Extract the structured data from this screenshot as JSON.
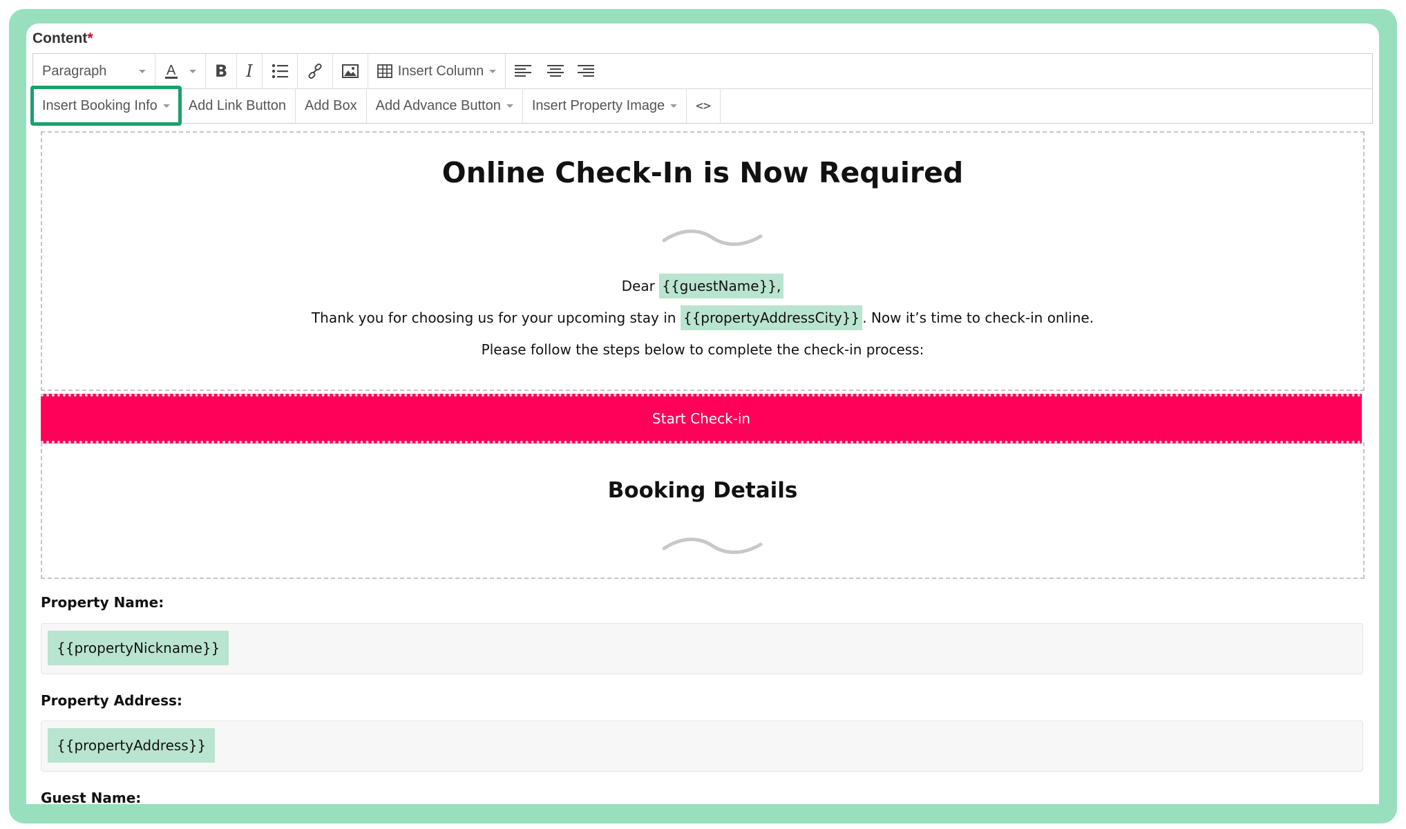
{
  "form": {
    "content_label": "Content",
    "required_mark": "*"
  },
  "toolbar": {
    "paragraph_select": "Paragraph",
    "insert_column": "Insert Column",
    "insert_booking_info": "Insert Booking Info",
    "add_link_button": "Add Link Button",
    "add_box": "Add Box",
    "add_advance_button": "Add Advance Button",
    "insert_property_image": "Insert Property Image",
    "code_view": "<>",
    "highlight_color": "#1aa06c"
  },
  "email": {
    "title": "Online Check-In is Now Required",
    "greeting_prefix": "Dear ",
    "guest_name_tag": "{{guestName}},",
    "line2_prefix": "Thank you for choosing us for your upcoming stay in ",
    "city_tag": "{{propertyAddressCity}}",
    "line2_suffix": ". Now it’s time to check-in online.",
    "line3": "Please follow the steps below to complete the check-in process:",
    "cta_label": "Start Check-in",
    "cta_color": "#ff0158",
    "booking_details_title": "Booking Details",
    "fields": [
      {
        "label": "Property Name:",
        "tag": "{{propertyNickname}}"
      },
      {
        "label": "Property Address:",
        "tag": "{{propertyAddress}}"
      },
      {
        "label": "Guest Name:"
      }
    ]
  },
  "colors": {
    "frame": "#98e0bd",
    "tag_bg": "#b9e4d0"
  }
}
